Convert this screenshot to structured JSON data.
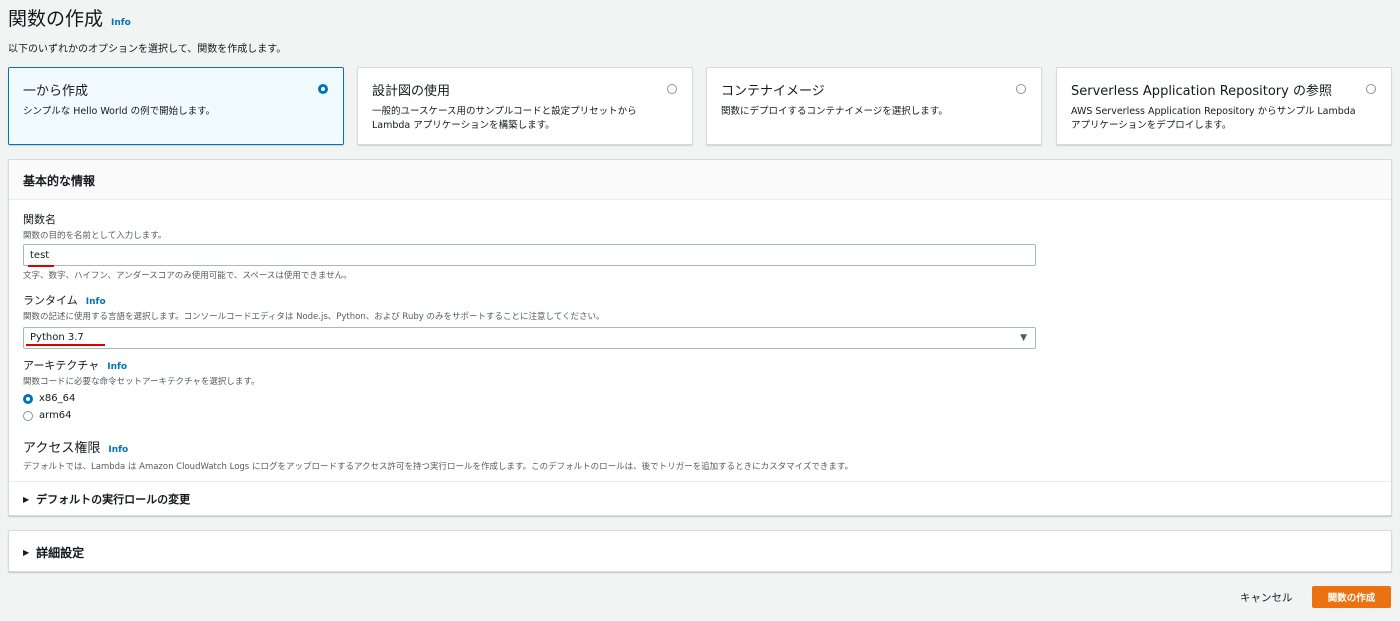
{
  "header": {
    "title": "関数の作成",
    "info": "Info",
    "subtitle": "以下のいずれかのオプションを選択して、関数を作成します。"
  },
  "options": [
    {
      "title": "一から作成",
      "desc": "シンプルな Hello World の例で開始します。",
      "selected": true
    },
    {
      "title": "設計図の使用",
      "desc": "一般的ユースケース用のサンプルコードと設定プリセットから Lambda アプリケーションを構築します。",
      "selected": false
    },
    {
      "title": "コンテナイメージ",
      "desc": "関数にデプロイするコンテナイメージを選択します。",
      "selected": false
    },
    {
      "title": "Serverless Application Repository の参照",
      "desc": "AWS Serverless Application Repository からサンプル Lambda アプリケーションをデプロイします。",
      "selected": false
    }
  ],
  "basic": {
    "header": "基本的な情報",
    "function_name": {
      "label": "関数名",
      "desc": "関数の目的を名前として入力します。",
      "value": "test",
      "constraint": "文字、数字、ハイフン、アンダースコアのみ使用可能で、スペースは使用できません。"
    },
    "runtime": {
      "label": "ランタイム",
      "info": "Info",
      "desc": "関数の記述に使用する言語を選択します。コンソールコードエディタは Node.js、Python、および Ruby のみをサポートすることに注意してください。",
      "value": "Python 3.7"
    },
    "architecture": {
      "label": "アーキテクチャ",
      "info": "Info",
      "desc": "関数コードに必要な命令セットアーキテクチャを選択します。",
      "options": [
        {
          "label": "x86_64",
          "checked": true
        },
        {
          "label": "arm64",
          "checked": false
        }
      ]
    },
    "permissions": {
      "label": "アクセス権限",
      "info": "Info",
      "desc": "デフォルトでは、Lambda は Amazon CloudWatch Logs にログをアップロードするアクセス許可を持つ実行ロールを作成します。このデフォルトのロールは、後でトリガーを追加するときにカスタマイズできます。"
    },
    "role_expander": "デフォルトの実行ロールの変更"
  },
  "advanced": {
    "label": "詳細設定"
  },
  "footer": {
    "cancel": "キャンセル",
    "create": "関数の作成"
  },
  "colors": {
    "accent": "#0073bb",
    "primary_button": "#ec7211",
    "annotation": "#d90000"
  },
  "icons": {
    "expand": "caret-right-icon",
    "dropdown": "caret-down-icon"
  }
}
